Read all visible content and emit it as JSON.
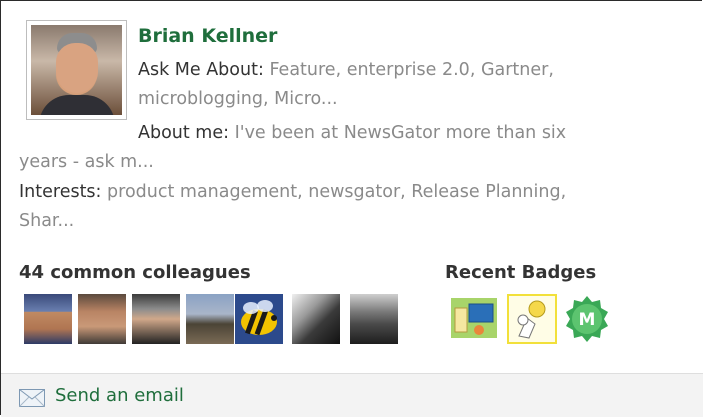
{
  "profile": {
    "name": "Brian Kellner",
    "ask_label": "Ask Me About:",
    "ask_value_line1": "Feature, enterprise 2.0, Gartner,",
    "ask_value_line2": "microblogging, Micro...",
    "about_label": "About me:",
    "about_value_line1": "I've been at NewsGator more than six",
    "about_value_line2": "years - ask m...",
    "interests_label": "Interests:",
    "interests_value_line1": "product management, newsgator, Release Planning,",
    "interests_value_line2": "Shar..."
  },
  "colleagues": {
    "title": "44 common colleagues",
    "avatars": [
      "colleague-1",
      "colleague-2",
      "colleague-3",
      "colleague-4",
      "bee-avatar",
      "colleague-6",
      "colleague-7"
    ]
  },
  "badges": {
    "title": "Recent Badges",
    "items": [
      "computer-badge-icon",
      "lightbulb-badge-icon",
      "m-badge-icon"
    ],
    "m_badge_letter": "M"
  },
  "footer": {
    "send_email_label": "Send an email",
    "icon": "envelope-icon"
  },
  "colors": {
    "accent_green": "#1f6e3c",
    "text_grey": "#8a8a8a"
  }
}
